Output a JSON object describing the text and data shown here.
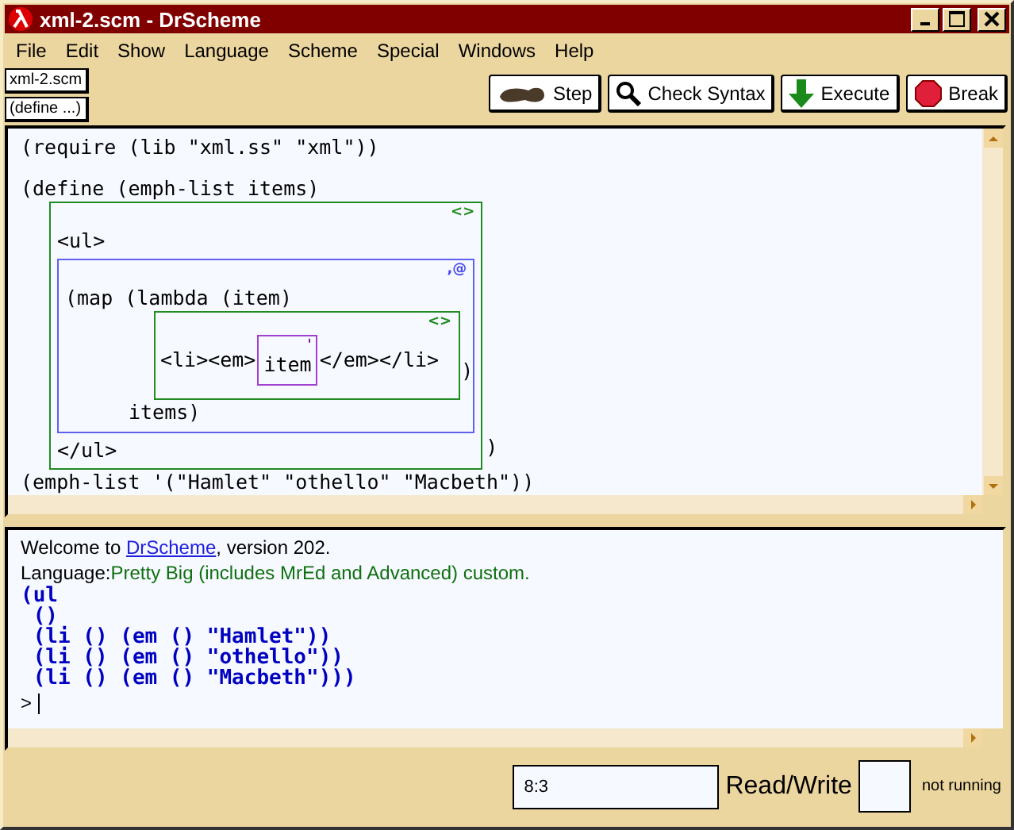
{
  "window": {
    "title": "xml-2.scm - DrScheme"
  },
  "menu": [
    "File",
    "Edit",
    "Show",
    "Language",
    "Scheme",
    "Special",
    "Windows",
    "Help"
  ],
  "file_button": "xml-2.scm",
  "define_button": "(define ...)",
  "toolbar": [
    {
      "label": "Step",
      "kind": "step"
    },
    {
      "label": "Check Syntax",
      "kind": "check"
    },
    {
      "label": "Execute",
      "kind": "execute"
    },
    {
      "label": "Break",
      "kind": "break"
    }
  ],
  "editor": {
    "lines_before": [
      "(require (lib \"xml.ss\" \"xml\"))",
      "(define (emph-list items)"
    ],
    "xml_box": {
      "badge": "<>",
      "open_tag": "<ul>",
      "splice_box": {
        "badge": ",@",
        "head": "(map (lambda (item)",
        "inner_box": {
          "badge": "<>",
          "before": "<li><em>",
          "scheme_box": {
            "badge": "'",
            "text": "item"
          },
          "after": "</em></li>"
        },
        "after_inner": ")",
        "tail": "items)"
      },
      "close_tag": "</ul>"
    },
    "after_box": ")",
    "lines_after": [
      "(emph-list '(\"Hamlet\" \"othello\" \"Macbeth\"))"
    ]
  },
  "interactions": {
    "welcome_before": "Welcome to ",
    "welcome_link": "DrScheme",
    "welcome_after": ", version 202.",
    "language_label": "Language: ",
    "language_value": "Pretty Big (includes MrEd and Advanced) custom.",
    "output": [
      "(ul",
      " ()",
      " (li () (em () \"Hamlet\"))",
      " (li () (em () \"othello\"))",
      " (li () (em () \"Macbeth\")))"
    ],
    "prompt": ">"
  },
  "status_bar": {
    "position": "8:3",
    "mode": "Read/Write",
    "state": "not running"
  }
}
